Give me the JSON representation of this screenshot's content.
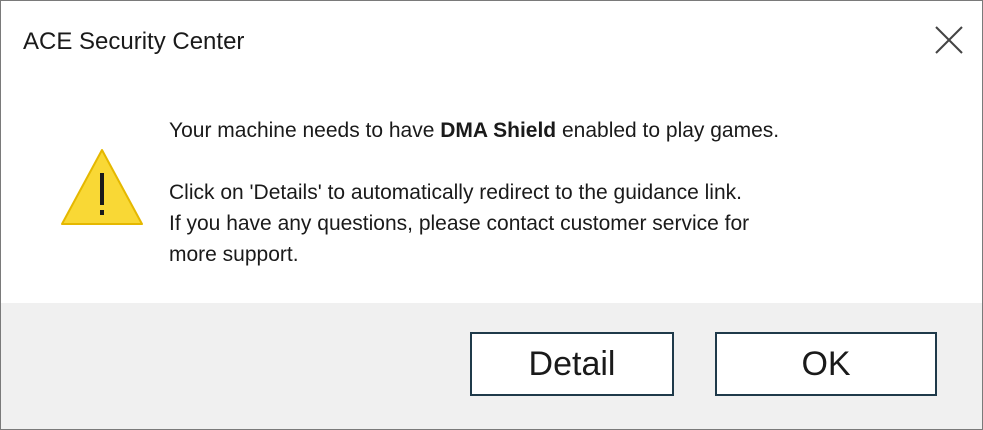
{
  "dialog": {
    "title": "ACE Security Center",
    "close_icon": "close-icon",
    "warning_icon": "warning-triangle-icon",
    "colors": {
      "warning_fill": "#f9d835",
      "warning_mark": "#1a1a1a",
      "footer_bg": "#f0f0f0",
      "button_border": "#1f3a4a"
    }
  },
  "message": {
    "line1_before": "Your machine needs to have ",
    "line1_bold": "DMA Shield",
    "line1_after": " enabled to play games.",
    "line2": "Click on 'Details' to automatically redirect to the guidance link.",
    "line3": "If you have any questions, please contact customer service for",
    "line4": "more support."
  },
  "buttons": {
    "detail_label": "Detail",
    "ok_label": "OK"
  }
}
